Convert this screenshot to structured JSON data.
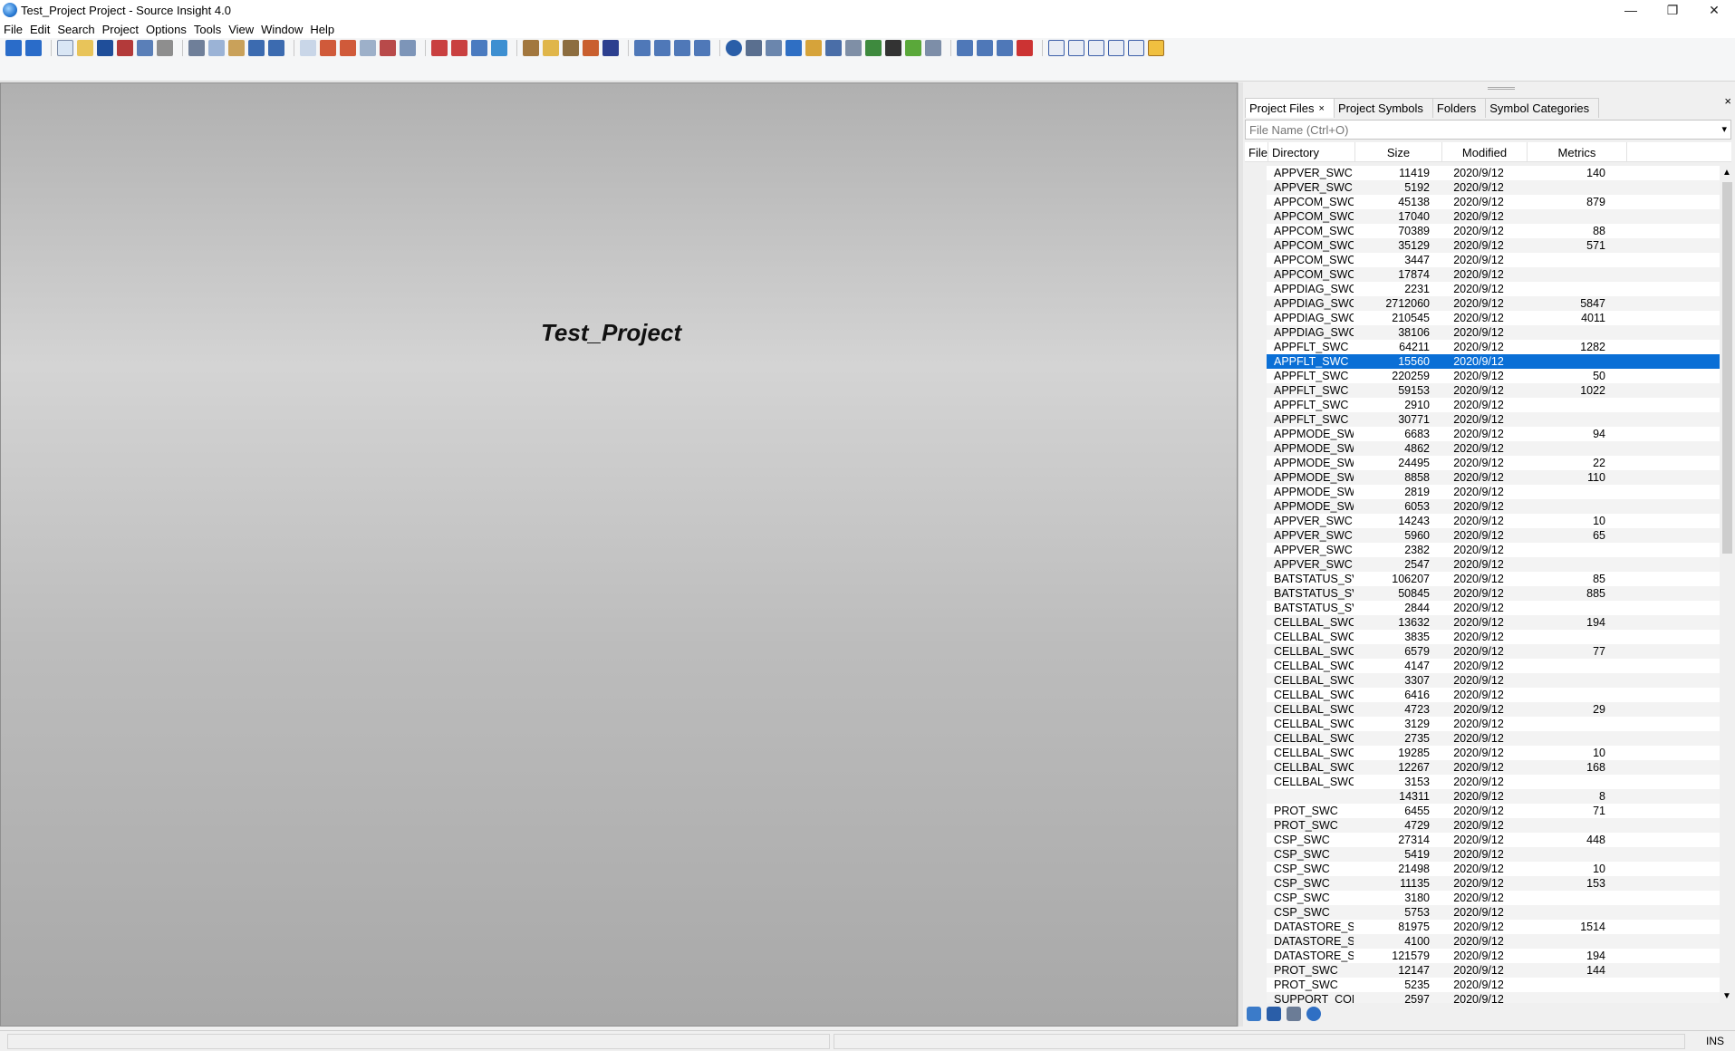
{
  "window": {
    "title": "Test_Project Project - Source Insight 4.0",
    "minimize": "—",
    "maximize": "❐",
    "close": "✕"
  },
  "menu": [
    "File",
    "Edit",
    "Search",
    "Project",
    "Options",
    "Tools",
    "View",
    "Window",
    "Help"
  ],
  "editor": {
    "title": "Test_Project"
  },
  "panel": {
    "close": "×",
    "tabs": [
      {
        "label": "Project Files",
        "close": "×"
      },
      {
        "label": "Project Symbols"
      },
      {
        "label": "Folders"
      },
      {
        "label": "Symbol Categories"
      }
    ],
    "filter_placeholder": "File Name (Ctrl+O)",
    "columns": {
      "file": "File",
      "directory": "Directory",
      "size": "Size",
      "modified": "Modified",
      "metrics": "Metrics"
    }
  },
  "rows": [
    [
      "APPVER_SWC",
      "11419",
      "2020/9/12",
      "140"
    ],
    [
      "APPVER_SWC",
      "5192",
      "2020/9/12",
      ""
    ],
    [
      "APPCOM_SWC",
      "45138",
      "2020/9/12",
      "879"
    ],
    [
      "APPCOM_SWC",
      "17040",
      "2020/9/12",
      ""
    ],
    [
      "APPCOM_SWC",
      "70389",
      "2020/9/12",
      "88"
    ],
    [
      "APPCOM_SWC",
      "35129",
      "2020/9/12",
      "571"
    ],
    [
      "APPCOM_SWC",
      "3447",
      "2020/9/12",
      ""
    ],
    [
      "APPCOM_SWC",
      "17874",
      "2020/9/12",
      ""
    ],
    [
      "APPDIAG_SWC",
      "2231",
      "2020/9/12",
      ""
    ],
    [
      "APPDIAG_SWC",
      "2712060",
      "2020/9/12",
      "5847"
    ],
    [
      "APPDIAG_SWC",
      "210545",
      "2020/9/12",
      "4011"
    ],
    [
      "APPDIAG_SWC",
      "38106",
      "2020/9/12",
      ""
    ],
    [
      "APPFLT_SWC",
      "64211",
      "2020/9/12",
      "1282"
    ],
    [
      "APPFLT_SWC",
      "15560",
      "2020/9/12",
      ""
    ],
    [
      "APPFLT_SWC",
      "220259",
      "2020/9/12",
      "50"
    ],
    [
      "APPFLT_SWC",
      "59153",
      "2020/9/12",
      "1022"
    ],
    [
      "APPFLT_SWC",
      "2910",
      "2020/9/12",
      ""
    ],
    [
      "APPFLT_SWC",
      "30771",
      "2020/9/12",
      ""
    ],
    [
      "APPMODE_SW",
      "6683",
      "2020/9/12",
      "94"
    ],
    [
      "APPMODE_SW",
      "4862",
      "2020/9/12",
      ""
    ],
    [
      "APPMODE_SW",
      "24495",
      "2020/9/12",
      "22"
    ],
    [
      "APPMODE_SW",
      "8858",
      "2020/9/12",
      "110"
    ],
    [
      "APPMODE_SW",
      "2819",
      "2020/9/12",
      ""
    ],
    [
      "APPMODE_SW",
      "6053",
      "2020/9/12",
      ""
    ],
    [
      "APPVER_SWC",
      "14243",
      "2020/9/12",
      "10"
    ],
    [
      "APPVER_SWC",
      "5960",
      "2020/9/12",
      "65"
    ],
    [
      "APPVER_SWC",
      "2382",
      "2020/9/12",
      ""
    ],
    [
      "APPVER_SWC",
      "2547",
      "2020/9/12",
      ""
    ],
    [
      "BATSTATUS_SV",
      "106207",
      "2020/9/12",
      "85"
    ],
    [
      "BATSTATUS_SV",
      "50845",
      "2020/9/12",
      "885"
    ],
    [
      "BATSTATUS_SV",
      "2844",
      "2020/9/12",
      ""
    ],
    [
      "CELLBAL_SWC",
      "13632",
      "2020/9/12",
      "194"
    ],
    [
      "CELLBAL_SWC",
      "3835",
      "2020/9/12",
      ""
    ],
    [
      "CELLBAL_SWC",
      "6579",
      "2020/9/12",
      "77"
    ],
    [
      "CELLBAL_SWC",
      "4147",
      "2020/9/12",
      ""
    ],
    [
      "CELLBAL_SWC",
      "3307",
      "2020/9/12",
      ""
    ],
    [
      "CELLBAL_SWC",
      "6416",
      "2020/9/12",
      ""
    ],
    [
      "CELLBAL_SWC",
      "4723",
      "2020/9/12",
      "29"
    ],
    [
      "CELLBAL_SWC",
      "3129",
      "2020/9/12",
      ""
    ],
    [
      "CELLBAL_SWC",
      "2735",
      "2020/9/12",
      ""
    ],
    [
      "CELLBAL_SWC",
      "19285",
      "2020/9/12",
      "10"
    ],
    [
      "CELLBAL_SWC",
      "12267",
      "2020/9/12",
      "168"
    ],
    [
      "CELLBAL_SWC",
      "3153",
      "2020/9/12",
      ""
    ],
    [
      "",
      "14311",
      "2020/9/12",
      "8"
    ],
    [
      "PROT_SWC",
      "6455",
      "2020/9/12",
      "71"
    ],
    [
      "PROT_SWC",
      "4729",
      "2020/9/12",
      ""
    ],
    [
      "CSP_SWC",
      "27314",
      "2020/9/12",
      "448"
    ],
    [
      "CSP_SWC",
      "5419",
      "2020/9/12",
      ""
    ],
    [
      "CSP_SWC",
      "21498",
      "2020/9/12",
      "10"
    ],
    [
      "CSP_SWC",
      "11135",
      "2020/9/12",
      "153"
    ],
    [
      "CSP_SWC",
      "3180",
      "2020/9/12",
      ""
    ],
    [
      "CSP_SWC",
      "5753",
      "2020/9/12",
      ""
    ],
    [
      "DATASTORE_S\\",
      "81975",
      "2020/9/12",
      "1514"
    ],
    [
      "DATASTORE_S\\",
      "4100",
      "2020/9/12",
      ""
    ],
    [
      "DATASTORE_S\\",
      "121579",
      "2020/9/12",
      "194"
    ],
    [
      "PROT_SWC",
      "12147",
      "2020/9/12",
      "144"
    ],
    [
      "PROT_SWC",
      "5235",
      "2020/9/12",
      ""
    ],
    [
      "SUPPORT_CON",
      "2597",
      "2020/9/12",
      ""
    ]
  ],
  "selected_row": 13,
  "status": {
    "mode": "INS"
  },
  "colors": {
    "selection": "#0a6fd6"
  }
}
